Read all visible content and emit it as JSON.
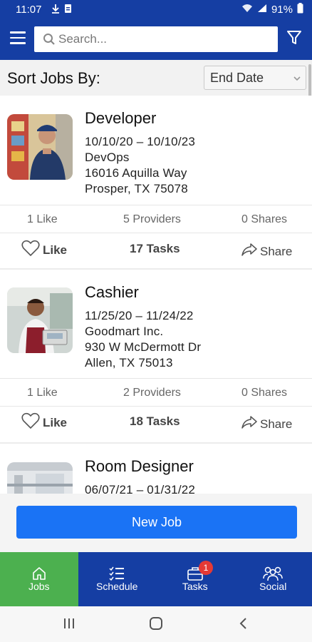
{
  "status_bar": {
    "time": "11:07",
    "battery": "91%"
  },
  "header": {
    "search_placeholder": "Search...",
    "icons": [
      "menu-icon",
      "search-icon",
      "filter-icon"
    ]
  },
  "sort": {
    "label": "Sort Jobs By:",
    "selected": "End Date"
  },
  "jobs": [
    {
      "title": "Developer",
      "dates": "10/10/20 – 10/10/23",
      "company": "DevOps",
      "address": "16016 Aquilla Way",
      "city": "Prosper, TX 75078",
      "likes": "1 Like",
      "providers": "5 Providers",
      "shares": "0 Shares",
      "like_label": "Like",
      "tasks": "17 Tasks",
      "share_label": "Share"
    },
    {
      "title": "Cashier",
      "dates": "11/25/20 – 11/24/22",
      "company": "Goodmart Inc.",
      "address": "930 W McDermott Dr",
      "city": "Allen, TX 75013",
      "likes": "1 Like",
      "providers": "2 Providers",
      "shares": "0 Shares",
      "like_label": "Like",
      "tasks": "18 Tasks",
      "share_label": "Share"
    },
    {
      "title": "Room Designer",
      "dates": "06/07/21 – 01/31/22"
    }
  ],
  "new_job_label": "New Job",
  "bottom_nav": {
    "jobs": "Jobs",
    "schedule": "Schedule",
    "tasks": "Tasks",
    "tasks_badge": "1",
    "social": "Social"
  },
  "colors": {
    "primary": "#153ea3",
    "accent_button": "#1a73f5",
    "active_nav": "#4cb04f",
    "badge": "#e53935"
  }
}
